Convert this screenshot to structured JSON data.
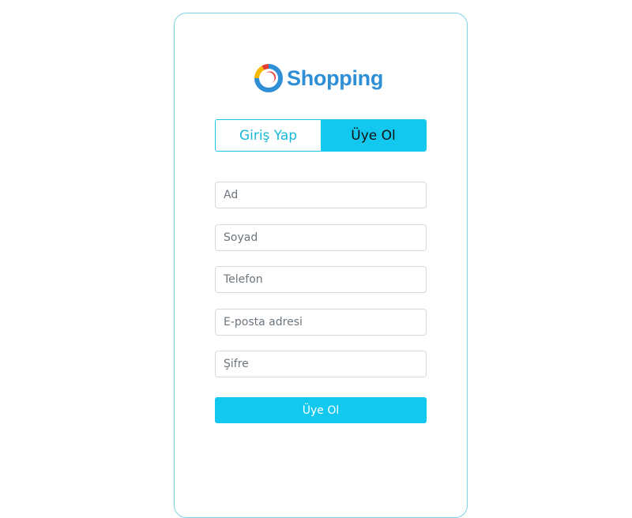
{
  "brand": {
    "name": "Shopping",
    "text_color": "#2f8fd6"
  },
  "tabs": [
    {
      "label": "Giriş Yap",
      "active": false
    },
    {
      "label": "Üye Ol",
      "active": true
    }
  ],
  "form": {
    "fields": [
      {
        "placeholder": "Ad",
        "value": ""
      },
      {
        "placeholder": "Soyad",
        "value": ""
      },
      {
        "placeholder": "Telefon",
        "value": ""
      },
      {
        "placeholder": "E-posta adresi",
        "value": ""
      },
      {
        "placeholder": "Şifre",
        "value": ""
      }
    ],
    "submit_label": "Üye Ol"
  },
  "colors": {
    "accent": "#12c8ee",
    "card_border": "#7fd3e3",
    "input_border": "#d5d8dc"
  },
  "icons": {
    "logo": "shopping-logo-icon"
  }
}
